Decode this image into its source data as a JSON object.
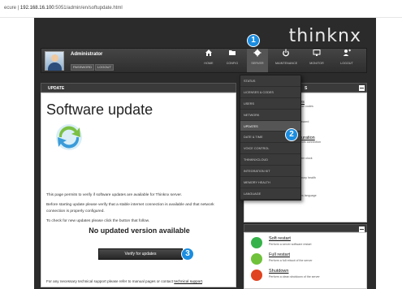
{
  "browser": {
    "scheme": "ecure | ",
    "host": "192.168.16.100",
    "path": ":5051/admin/en/softupdate.html"
  },
  "app": {
    "brand": "thinknx"
  },
  "user": {
    "name": "Administrator",
    "password_btn": "PASSWORD",
    "logout_btn": "LOGOUT"
  },
  "nav": [
    {
      "label": "HOME",
      "icon": "home-icon"
    },
    {
      "label": "CONFIG",
      "icon": "folder-icon"
    },
    {
      "label": "SERVER",
      "icon": "gear-icon"
    },
    {
      "label": "MAINTENANCE",
      "icon": "power-icon"
    },
    {
      "label": "MONITOR",
      "icon": "monitor-icon"
    },
    {
      "label": "LOGOUT",
      "icon": "user-logout-icon"
    }
  ],
  "menu": {
    "items": [
      "STATUS",
      "LICENSES & CODES",
      "USERS",
      "NETWORK",
      "UPDATES",
      "DATE & TIME",
      "VOICE CONTROL",
      "THINKNXCLOUD",
      "INTEGRATION KIT",
      "MEMORY HEALTH",
      "LANGUAGE"
    ],
    "selected": "UPDATES"
  },
  "callouts": [
    "1",
    "2",
    "3"
  ],
  "main": {
    "panel_title": "UPDATE",
    "title": "Software update",
    "p1": "This page permits to verify if software updates are available for Thinknx server.",
    "p2": "Before starting update please verify that a stable internet connection is available and that network connection is properly configured.",
    "p3": "To check for new updates please click the button that follow.",
    "status": "No updated version available",
    "verify_btn": "Verify for updates",
    "footer_text": "For any necessary technical support please refer to manual pages or contact ",
    "footer_link": "technical support",
    "footer_end": "."
  },
  "right_panel": {
    "title": "S",
    "items": [
      {
        "title": "Codes",
        "desc": "ge license codes"
      },
      {
        "title": "",
        "desc": "ver password"
      },
      {
        "title": "onfiguration",
        "desc": "ge network connection"
      },
      {
        "title": "e",
        "desc": "ge system clock"
      },
      {
        "title": "ealth",
        "desc": "ver memory health"
      },
      {
        "title": "",
        "desc": "ge pages language"
      }
    ]
  },
  "server_actions": [
    {
      "title": "Soft restart",
      "desc": "Perform a server software restart",
      "color": "#36b24a"
    },
    {
      "title": "Full restart",
      "desc": "Perform a full reboot of the server",
      "color": "#6fc23a"
    },
    {
      "title": "Shutdown",
      "desc": "Perform a clean shutdown of the server",
      "color": "#e0431f"
    }
  ]
}
